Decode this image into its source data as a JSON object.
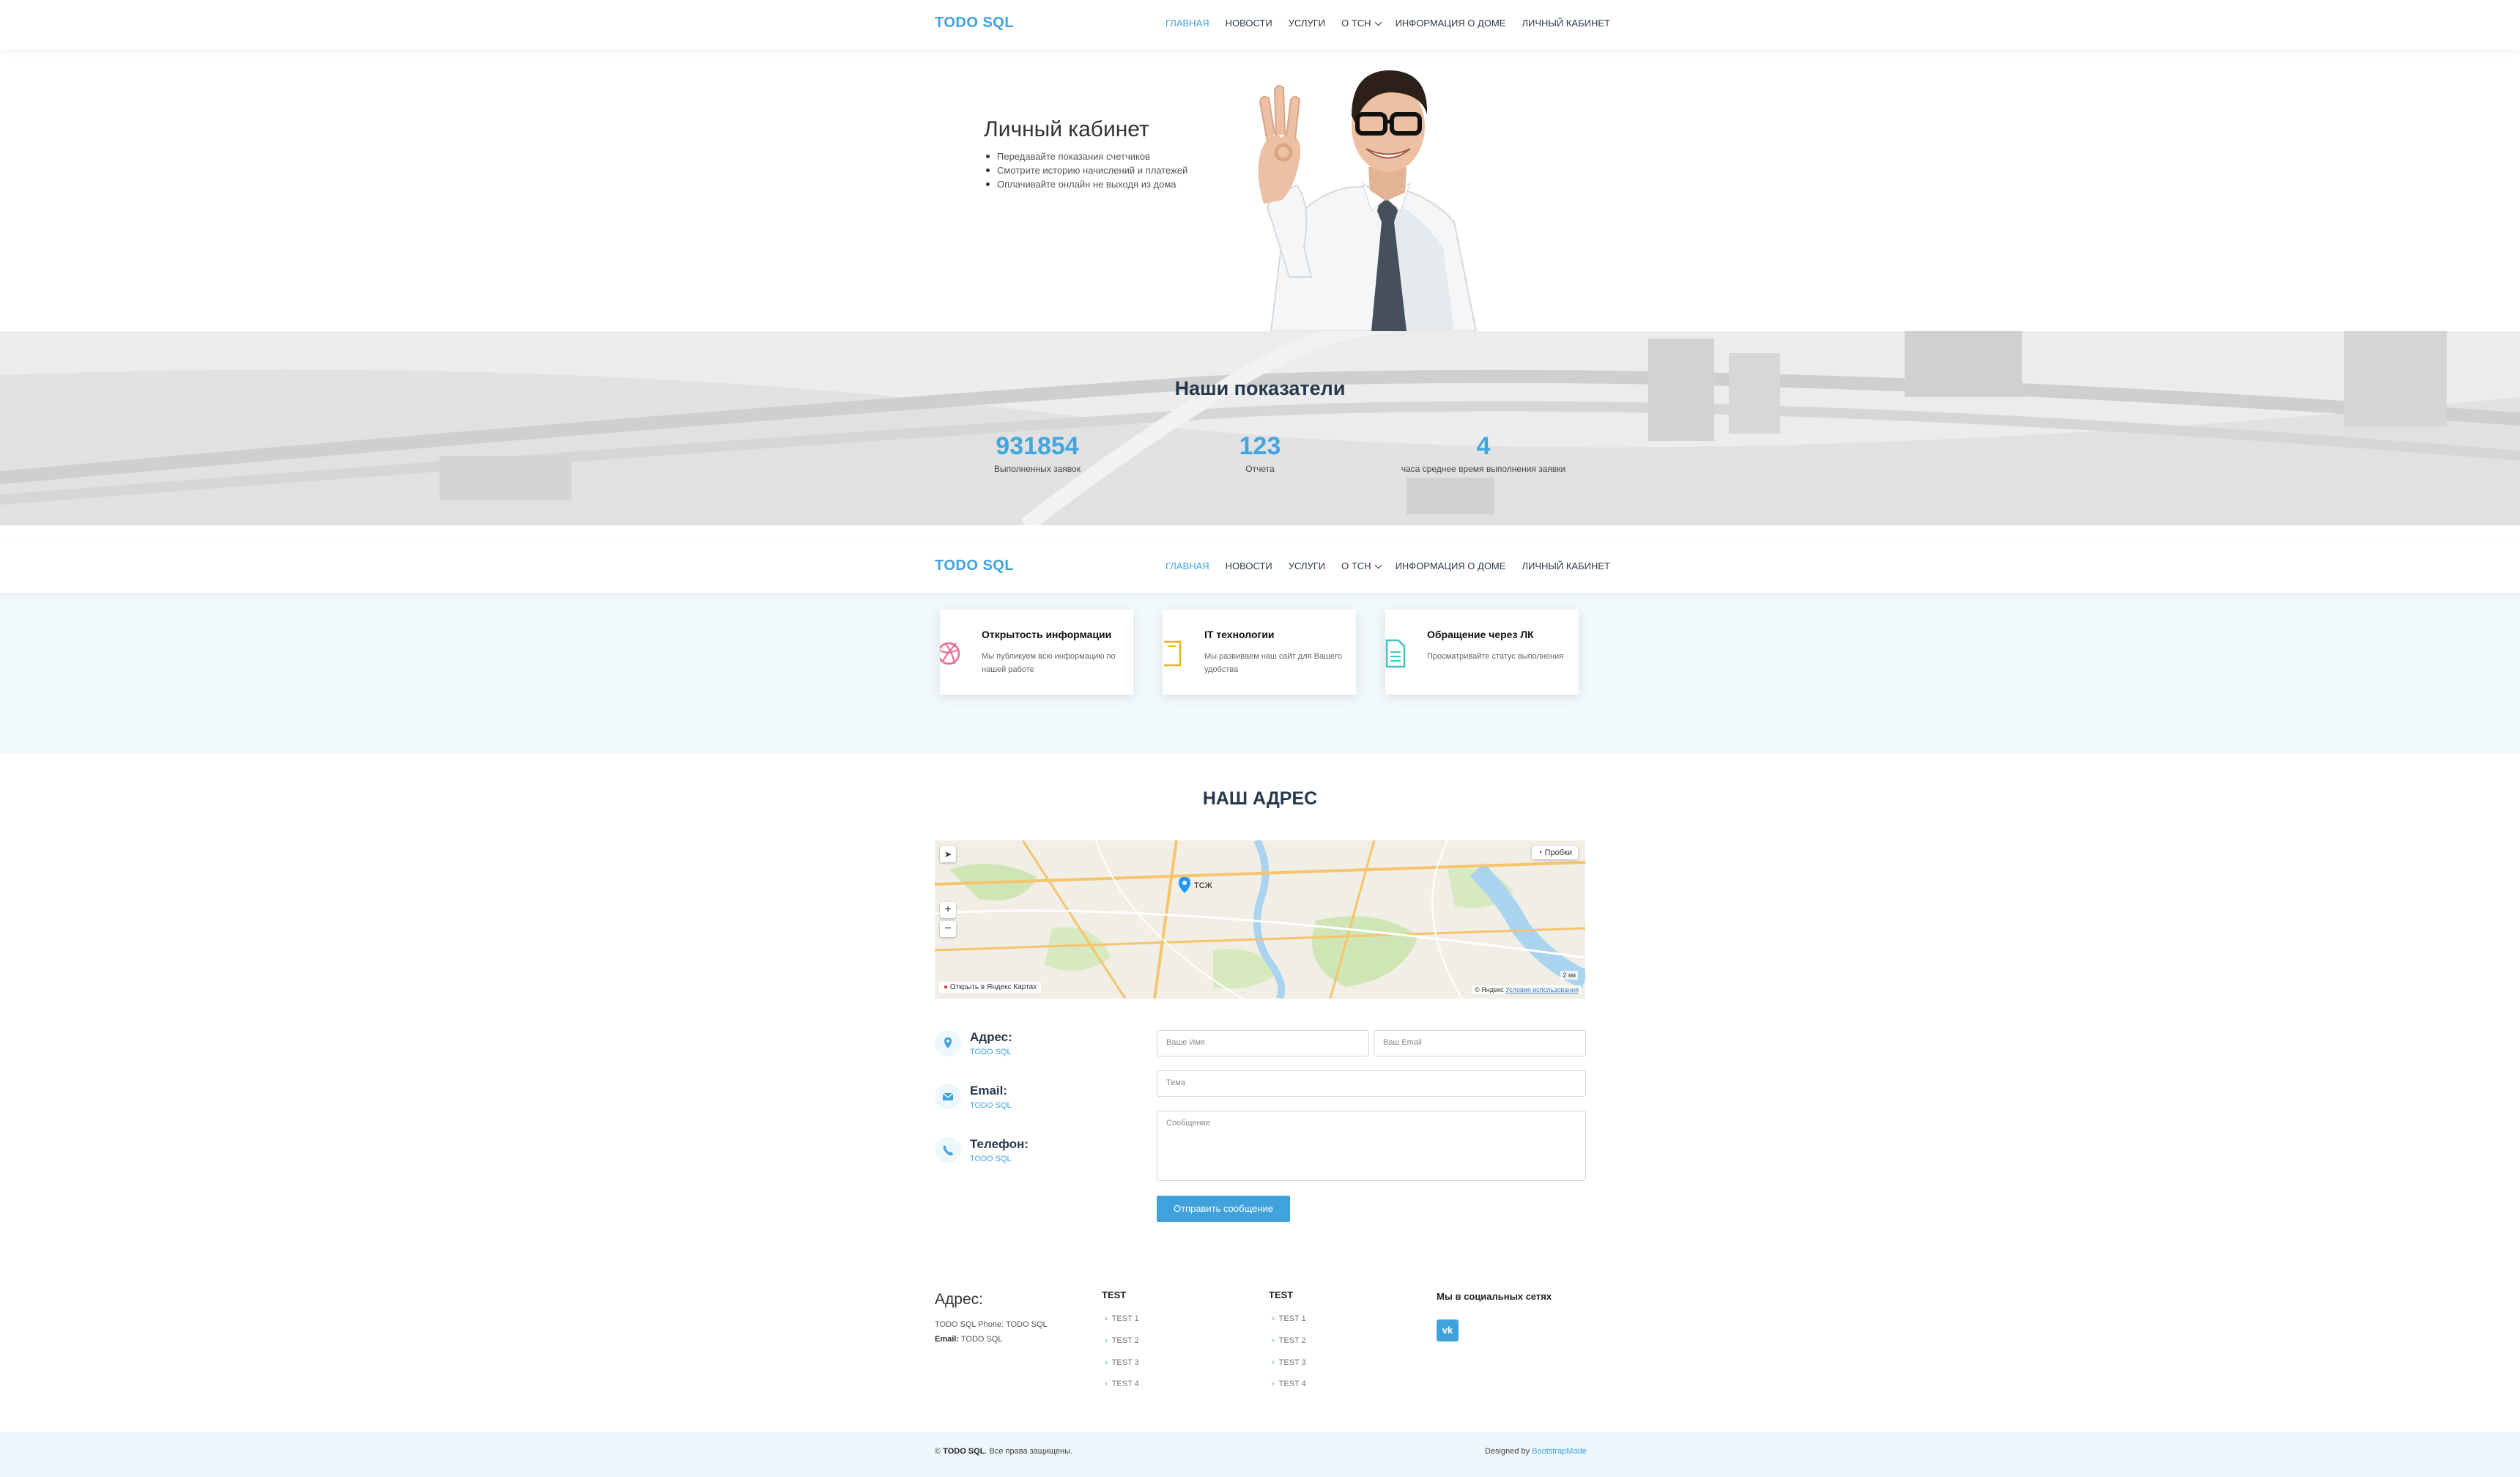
{
  "header": {
    "logo": "TODO SQL",
    "nav": [
      "ГЛАВНАЯ",
      "НОВОСТИ",
      "УСЛУГИ",
      "О ТСН",
      "ИНФОРМАЦИЯ О ДОМЕ",
      "ЛИЧНЫЙ КАБИНЕТ"
    ],
    "active_index": 0
  },
  "hero": {
    "title": "Личный кабинет",
    "bullets": [
      "Передавайте показания счетчиков",
      "Смотрите историю начислений и платежей",
      "Оплачивайте онлайн не выходя из дома"
    ]
  },
  "stats": {
    "title": "Наши показатели",
    "items": [
      {
        "value": "931854",
        "label": "Выполненных заявок"
      },
      {
        "value": "123",
        "label": "Отчета"
      },
      {
        "value": "4",
        "label": "часа среднее время выполнения заявки"
      }
    ]
  },
  "features": [
    {
      "icon": "dribbble-icon",
      "color": "#e9678f",
      "title": "Открытость информации",
      "text": "Мы публикуем всю информацию по нашей работе"
    },
    {
      "icon": "book-icon",
      "color": "#e8b40e",
      "title": "IT технологии",
      "text": "Мы развиваем наш сайт для Вашего удобства"
    },
    {
      "icon": "document-icon",
      "color": "#3bc7c0",
      "title": "Обращение через ЛК",
      "text": "Просматривайте статус выполнения"
    }
  ],
  "address_section": {
    "title": "НАШ АДРЕС",
    "map": {
      "traffic_label": "Пробки",
      "open_label": "Открыть в Яндекс Картах",
      "pin_label": "ТСЖ",
      "copyright": "© Яндекс",
      "terms": "Условия использования",
      "scale": "2 км"
    },
    "info": [
      {
        "icon": "map-pin-icon",
        "title": "Адрес:",
        "value": "TODO SQL"
      },
      {
        "icon": "envelope-icon",
        "title": "Email:",
        "value": "TODO SQL"
      },
      {
        "icon": "phone-icon",
        "title": "Телефон:",
        "value": "TODO SQL"
      }
    ],
    "form": {
      "name_placeholder": "Ваше Имя",
      "email_placeholder": "Ваш Email",
      "subject_placeholder": "Тема",
      "message_placeholder": "Сообщение",
      "submit": "Отправить сообщение"
    }
  },
  "footer": {
    "address_title": "Адрес:",
    "address_line1": "TODO SQL Phone: TODO SQL",
    "email_label": "Email:",
    "email_value": "TODO SQL",
    "columns": [
      {
        "title": "TEST",
        "links": [
          "TEST 1",
          "TEST 2",
          "TEST 3",
          "TEST 4"
        ]
      },
      {
        "title": "TEST",
        "links": [
          "TEST 1",
          "TEST 2",
          "TEST 3",
          "TEST 4"
        ]
      }
    ],
    "social_title": "Мы в социальных сетях",
    "social_vk": "vk",
    "copyright_brand": "TODO SQL",
    "copyright_text": "Все права защищены.",
    "credits_prefix": "Designed by",
    "credits_link": "BootstrapMade"
  }
}
